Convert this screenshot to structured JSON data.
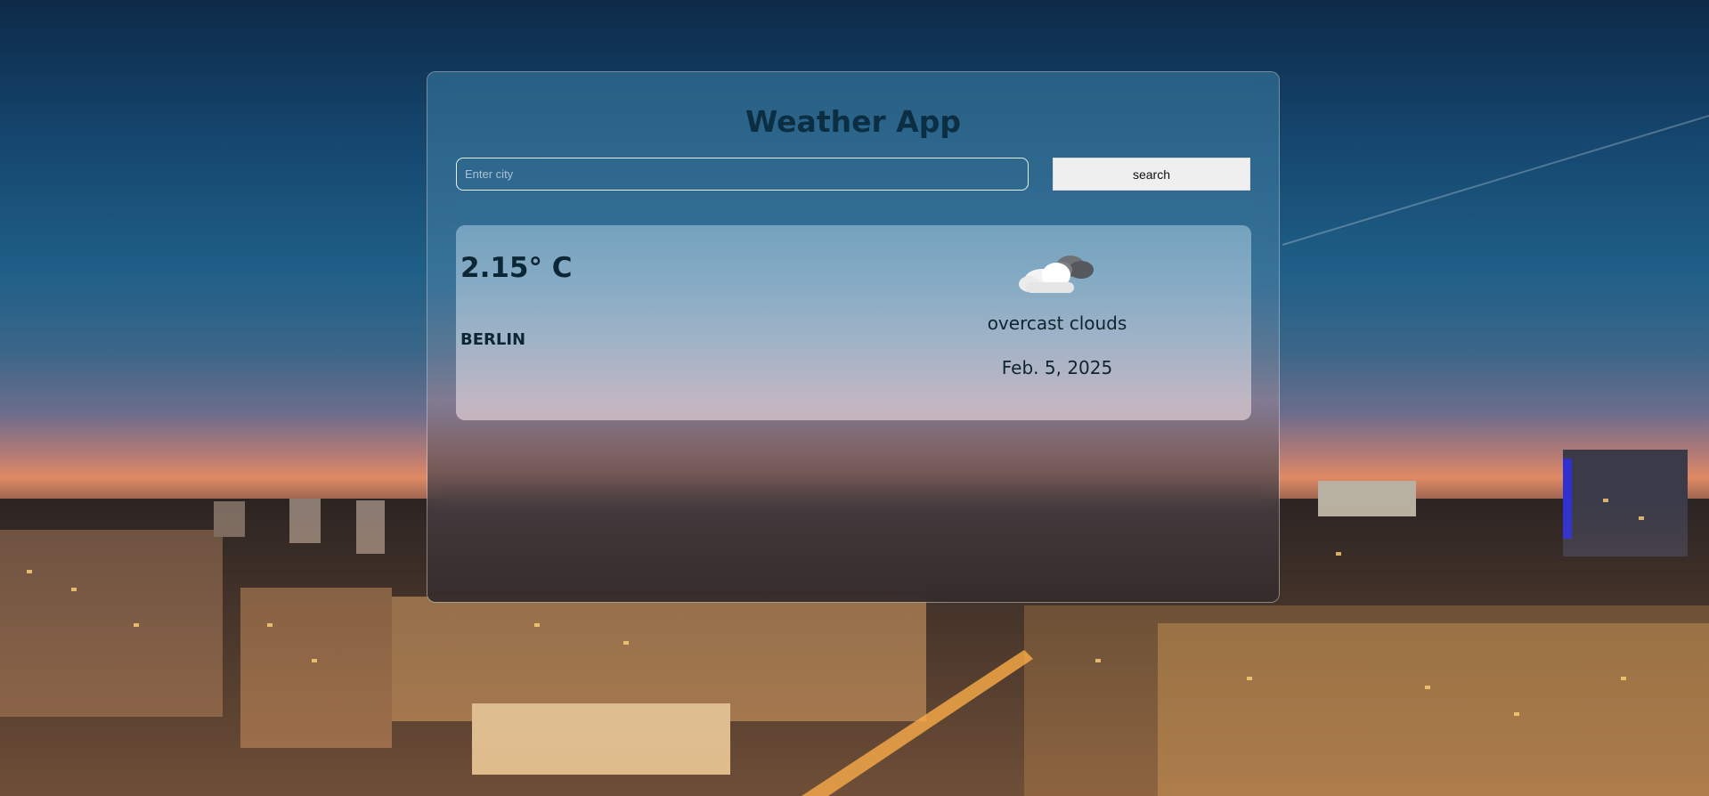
{
  "app": {
    "title": "Weather App"
  },
  "search": {
    "placeholder": "Enter city",
    "value": "",
    "button_label": "search"
  },
  "weather": {
    "temperature": "2.15° C",
    "city": "BERLIN",
    "description": "overcast clouds",
    "date": "Feb. 5, 2025",
    "icon": "cloud-icon"
  },
  "colors": {
    "title": "#0c2e42",
    "button_bg": "#efefef"
  }
}
